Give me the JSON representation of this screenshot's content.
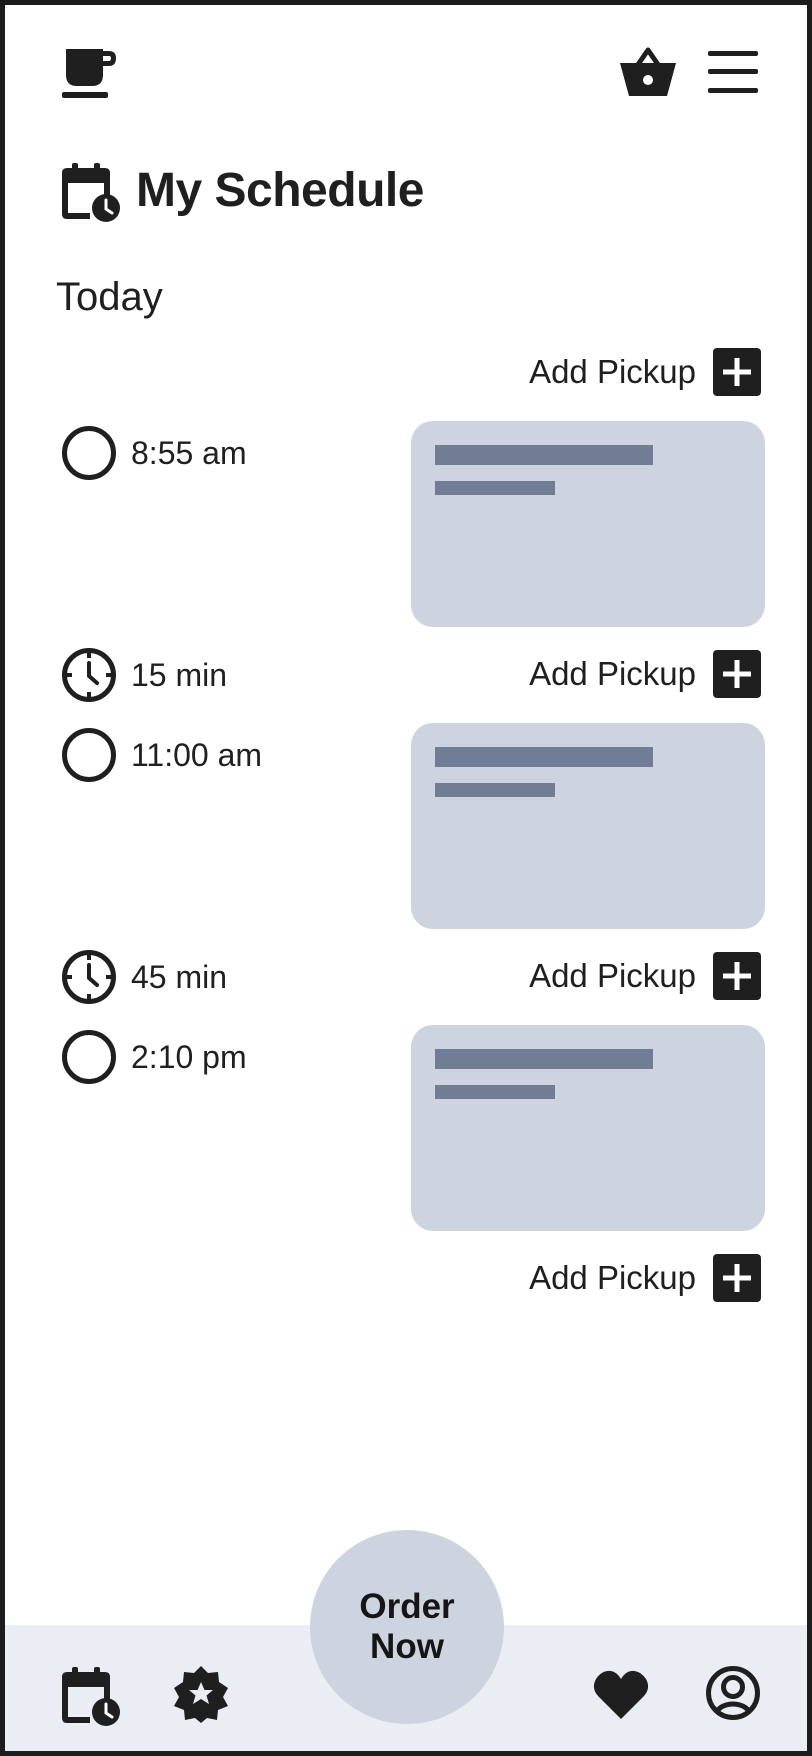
{
  "header": {
    "logo_icon": "coffee-cup-icon",
    "basket_icon": "basket-icon",
    "menu_icon": "hamburger-menu-icon"
  },
  "page": {
    "title": "My Schedule",
    "title_icon": "calendar-clock-icon",
    "section_label": "Today"
  },
  "add_pickup_label": "Add Pickup",
  "schedule": [
    {
      "time": "8:55 am"
    },
    {
      "time": "11:00 am"
    },
    {
      "time": "2:10 pm"
    }
  ],
  "gaps": [
    {
      "duration": "15 min"
    },
    {
      "duration": "45 min"
    }
  ],
  "bottom_nav": {
    "order_button": {
      "line1": "Order",
      "line2": "Now"
    },
    "items": [
      "calendar-clock-icon",
      "badge-star-icon",
      "heart-icon",
      "user-circle-icon"
    ]
  },
  "colors": {
    "card": "#cdd4e0",
    "card_bar": "#717c95",
    "nav_bg": "#eaedf4",
    "dark": "#1f1f1f"
  }
}
